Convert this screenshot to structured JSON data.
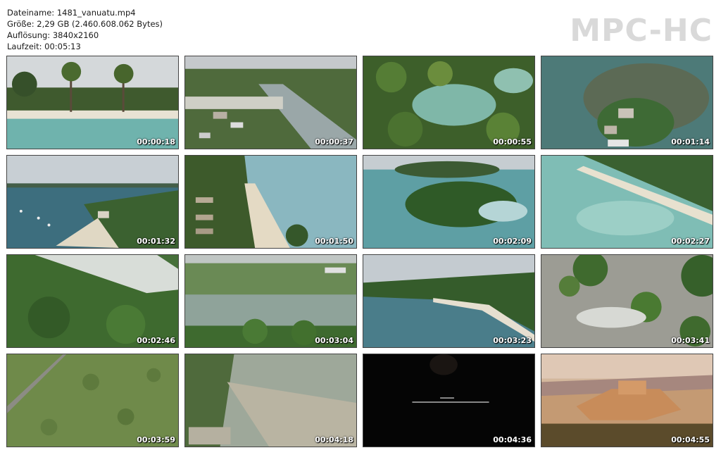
{
  "info": {
    "filename": "Dateiname: 1481_vanuatu.mp4",
    "size": "Größe: 2,29 GB (2.460.608.062 Bytes)",
    "resolution": "Auflösung: 3840x2160",
    "duration": "Laufzeit: 00:05:13"
  },
  "logo": "MPC-HC",
  "thumbnails": [
    {
      "timestamp": "00:00:18"
    },
    {
      "timestamp": "00:00:37"
    },
    {
      "timestamp": "00:00:55"
    },
    {
      "timestamp": "00:01:14"
    },
    {
      "timestamp": "00:01:32"
    },
    {
      "timestamp": "00:01:50"
    },
    {
      "timestamp": "00:02:09"
    },
    {
      "timestamp": "00:02:27"
    },
    {
      "timestamp": "00:02:46"
    },
    {
      "timestamp": "00:03:04"
    },
    {
      "timestamp": "00:03:23"
    },
    {
      "timestamp": "00:03:41"
    },
    {
      "timestamp": "00:03:59"
    },
    {
      "timestamp": "00:04:18"
    },
    {
      "timestamp": "00:04:36"
    },
    {
      "timestamp": "00:04:55"
    }
  ],
  "colors": {
    "logo": "#d9d9d9",
    "background": "#ffffff",
    "timestamp": "#ffffff"
  }
}
